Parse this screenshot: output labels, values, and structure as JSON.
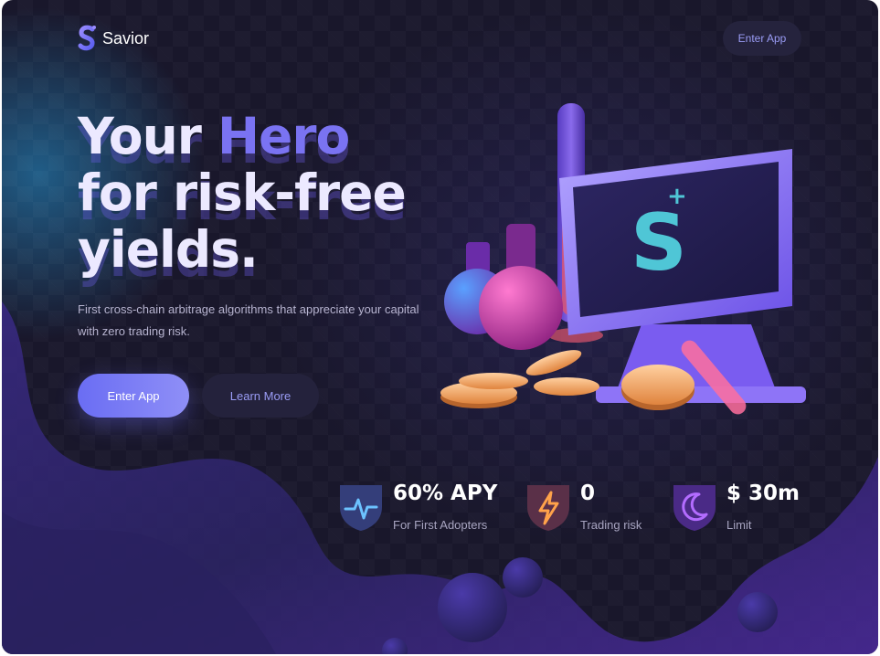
{
  "brand": {
    "name": "Savior"
  },
  "header": {
    "cta_label": "Enter App"
  },
  "hero": {
    "title_line1_plain": "Your ",
    "title_line1_accent": "Hero",
    "title_line2": "for risk-free",
    "title_line3": "yields.",
    "subtitle": "First cross-chain arbitrage algorithms that appreciate your capital with zero trading risk.",
    "primary_button": "Enter App",
    "secondary_button": "Learn More"
  },
  "stats": [
    {
      "value": "60% APY",
      "label": "For First Adopters",
      "icon": "pulse-icon"
    },
    {
      "value": "0",
      "label": "Trading risk",
      "icon": "lightning-icon"
    },
    {
      "value": "$ 30m",
      "label": "Limit",
      "icon": "moon-icon"
    }
  ],
  "colors": {
    "background": "#19172b",
    "accent": "#7a73f2",
    "button_gradient_start": "#6a6df3",
    "button_gradient_end": "#8f8ff7"
  }
}
